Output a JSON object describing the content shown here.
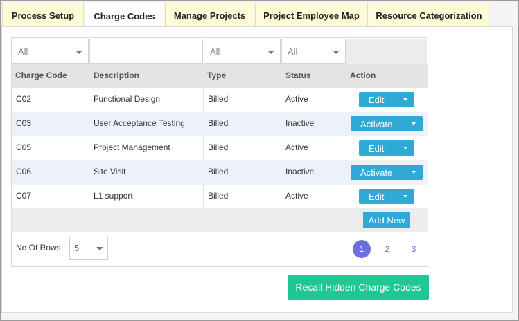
{
  "tabs": [
    "Process Setup",
    "Charge Codes",
    "Manage Projects",
    "Project Employee Map",
    "Resource Categorization"
  ],
  "active_tab": "Charge Codes",
  "filters": {
    "charge_code": "All",
    "description": "",
    "type": "All",
    "status": "All"
  },
  "columns": [
    "Charge Code",
    "Description",
    "Type",
    "Status",
    "Action"
  ],
  "rows": [
    {
      "code": "C02",
      "description": "Functional Design",
      "type": "Billed",
      "status": "Active",
      "action": "Edit"
    },
    {
      "code": "C03",
      "description": "User Acceptance Testing",
      "type": "Billed",
      "status": "Inactive",
      "action": "Activate"
    },
    {
      "code": "C05",
      "description": "Project Management",
      "type": "Billed",
      "status": "Active",
      "action": "Edit"
    },
    {
      "code": "C06",
      "description": "Site Visit",
      "type": "Billed",
      "status": "Inactive",
      "action": "Activate"
    },
    {
      "code": "C07",
      "description": "L1 support",
      "type": "Billed",
      "status": "Active",
      "action": "Edit"
    }
  ],
  "add_new_label": "Add New",
  "rows_per_page": {
    "label": "No Of Rows :",
    "value": "5"
  },
  "pagination": {
    "pages": [
      "1",
      "2",
      "3"
    ],
    "current": "1"
  },
  "recall_label": "Recall Hidden Charge Codes",
  "colors": {
    "primary_button": "#2fa9d6",
    "recall_button": "#1fc892",
    "active_page": "#6c6fe0",
    "tab_bg": "#fdfbd8"
  }
}
